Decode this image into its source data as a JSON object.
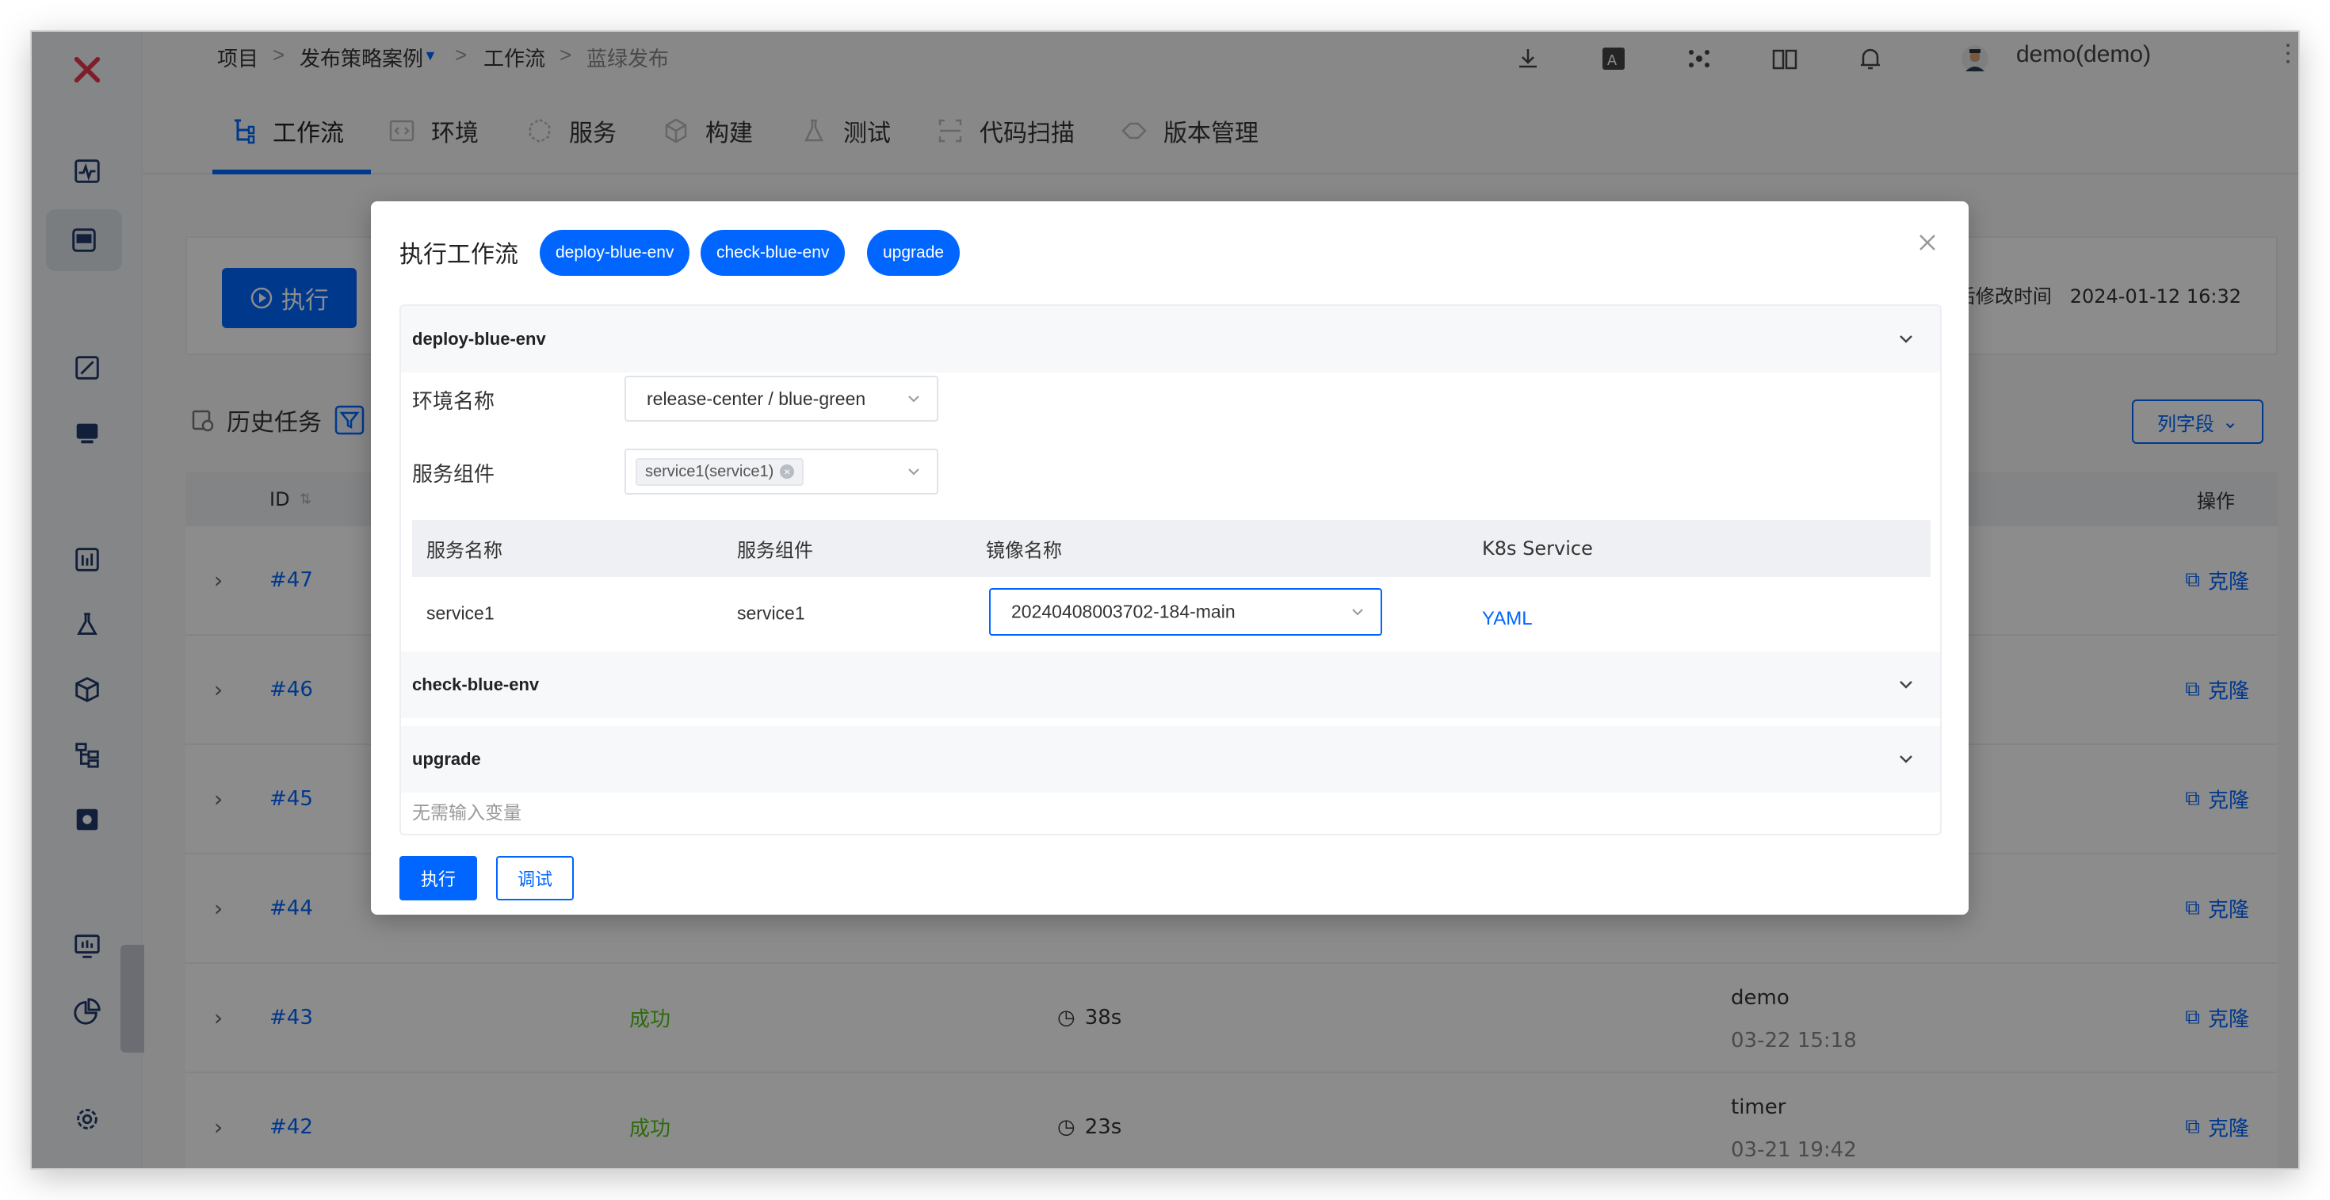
{
  "breadcrumb": {
    "root": "项目",
    "sep": ">",
    "project": "发布策略案例",
    "section": "工作流",
    "current": "蓝绿发布"
  },
  "user": {
    "name": "demo(demo)"
  },
  "tabs": [
    {
      "label": "工作流",
      "icon": "workflow-icon",
      "active": true
    },
    {
      "label": "环境",
      "icon": "environment-icon"
    },
    {
      "label": "服务",
      "icon": "service-icon"
    },
    {
      "label": "构建",
      "icon": "build-icon"
    },
    {
      "label": "测试",
      "icon": "test-icon"
    },
    {
      "label": "代码扫描",
      "icon": "code-scan-icon"
    },
    {
      "label": "版本管理",
      "icon": "version-icon"
    }
  ],
  "main": {
    "run_label": "执行",
    "modified_label": "最后修改时间",
    "modified_time": "2024-01-12 16:32",
    "history_title": "历史任务",
    "columns_button": "列字段",
    "table_headers": {
      "id": "ID",
      "actions": "操作"
    },
    "rows": [
      {
        "id": "#47",
        "status": "",
        "duration": "",
        "user": "",
        "time": "",
        "action": "克隆"
      },
      {
        "id": "#46",
        "status": "",
        "duration": "",
        "user": "",
        "time": "",
        "action": "克隆"
      },
      {
        "id": "#45",
        "status": "",
        "duration": "",
        "user": "",
        "time": "",
        "action": "克隆"
      },
      {
        "id": "#44",
        "status": "",
        "duration": "",
        "user": "",
        "time": "",
        "action": "克隆"
      },
      {
        "id": "#43",
        "status": "成功",
        "duration": "38s",
        "user": "demo",
        "time": "03-22 15:18",
        "action": "克隆"
      },
      {
        "id": "#42",
        "status": "成功",
        "duration": "23s",
        "user": "timer",
        "time": "03-21 19:42",
        "action": "克隆"
      }
    ]
  },
  "modal": {
    "title": "执行工作流",
    "pills": [
      "deploy-blue-env",
      "check-blue-env",
      "upgrade"
    ],
    "panels": {
      "deploy": {
        "title": "deploy-blue-env",
        "env_label": "环境名称",
        "env_value": "release-center / blue-green",
        "component_label": "服务组件",
        "component_tag": "service1(service1)",
        "table_headers": {
          "service_name": "服务名称",
          "component": "服务组件",
          "image": "镜像名称",
          "k8s": "K8s Service"
        },
        "row": {
          "service_name": "service1",
          "component": "service1",
          "image": "20240408003702-184-main",
          "k8s": "YAML"
        }
      },
      "check": {
        "title": "check-blue-env"
      },
      "upgrade": {
        "title": "upgrade",
        "no_input": "无需输入变量"
      }
    },
    "exec_button": "执行",
    "debug_button": "调试"
  },
  "colors": {
    "primary": "#0066ff",
    "success": "#52c41a",
    "logo": "#e8374f"
  }
}
